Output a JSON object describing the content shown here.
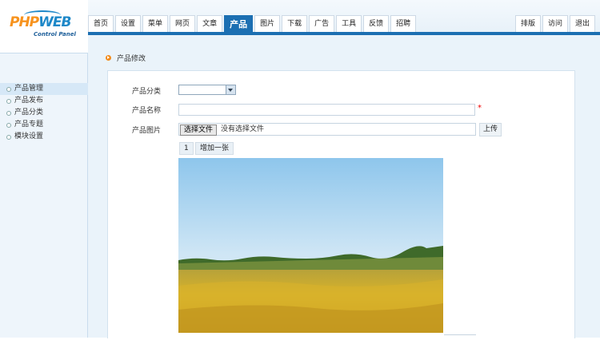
{
  "logo": {
    "php": "PHP",
    "web": "WEB",
    "subtitle": "Control Panel"
  },
  "nav": {
    "tabs": [
      "首页",
      "设置",
      "菜单",
      "网页",
      "文章",
      "产品",
      "图片",
      "下载",
      "广告",
      "工具",
      "反馈",
      "招聘"
    ],
    "active_tab": "产品",
    "right_tabs": [
      "排版",
      "访问",
      "退出"
    ]
  },
  "sidebar": {
    "items": [
      "产品管理",
      "产品发布",
      "产品分类",
      "产品专题",
      "模块设置"
    ],
    "active_index": 0
  },
  "breadcrumb": {
    "title": "产品修改"
  },
  "form": {
    "category_label": "产品分类",
    "category_value": "",
    "name_label": "产品名称",
    "name_value": "",
    "required_mark": "*",
    "image_label": "产品图片",
    "file_button": "选择文件",
    "file_status": "没有选择文件",
    "upload_button": "上传",
    "page_number": "1",
    "add_one_button": "增加一张"
  },
  "colors": {
    "accent": "#1c6fb2",
    "orange": "#f28a1a",
    "panel_bg": "#eaf3fa"
  }
}
